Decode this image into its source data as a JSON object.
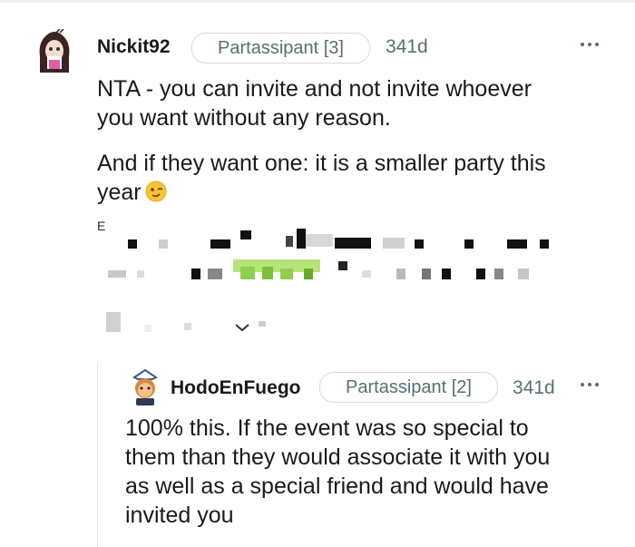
{
  "comment": {
    "username": "Nickit92",
    "flair": "Partassipant [3]",
    "age": "341d",
    "paragraphs": [
      [
        "NTA - you can invite and not invite whoever",
        "you want without any reason."
      ],
      [
        "And if they want one: it is a smaller party this",
        "year"
      ]
    ],
    "emoji": "winking-face",
    "obscured_edit_prefix": "E"
  },
  "reply": {
    "username": "HodoEnFuego",
    "flair": "Partassipant [2]",
    "age": "341d",
    "lines": [
      "100% this. If the event was so special to",
      "them than they would associate it with you",
      "as well as a special friend and would have",
      "invited you"
    ]
  },
  "icons": {
    "more": "more-horizontal-icon",
    "chevron": "chevron-down-icon",
    "emoji": "wink-emoji-icon"
  },
  "colors": {
    "text": "#1a1a1b",
    "meta": "#576f76",
    "flair_border": "#d7dadc",
    "pixelated_green": "#8fd14f"
  }
}
